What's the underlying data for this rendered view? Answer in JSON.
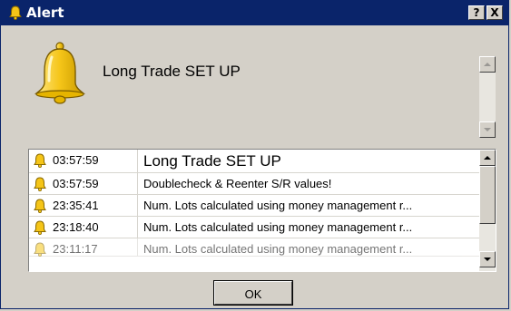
{
  "window": {
    "title": "Alert",
    "help_label": "?",
    "close_label": "X"
  },
  "alert": {
    "message": "Long Trade SET UP"
  },
  "log": {
    "rows": [
      {
        "icon": "bell-icon",
        "time": "03:57:59",
        "message": "Long Trade SET UP"
      },
      {
        "icon": "bell-icon",
        "time": "03:57:59",
        "message": "Doublecheck & Reenter S/R values!"
      },
      {
        "icon": "bell-icon",
        "time": "23:35:41",
        "message": "Num. Lots calculated using money management r..."
      },
      {
        "icon": "bell-icon",
        "time": "23:18:40",
        "message": "Num. Lots calculated using money management r..."
      },
      {
        "icon": "bell-icon",
        "time": "23:11:17",
        "message": "Num. Lots calculated using money management r..."
      }
    ]
  },
  "buttons": {
    "ok_label": "OK"
  },
  "colors": {
    "titlebar": "#0a246a",
    "face": "#d4d0c8",
    "bell": "#f5c518"
  }
}
